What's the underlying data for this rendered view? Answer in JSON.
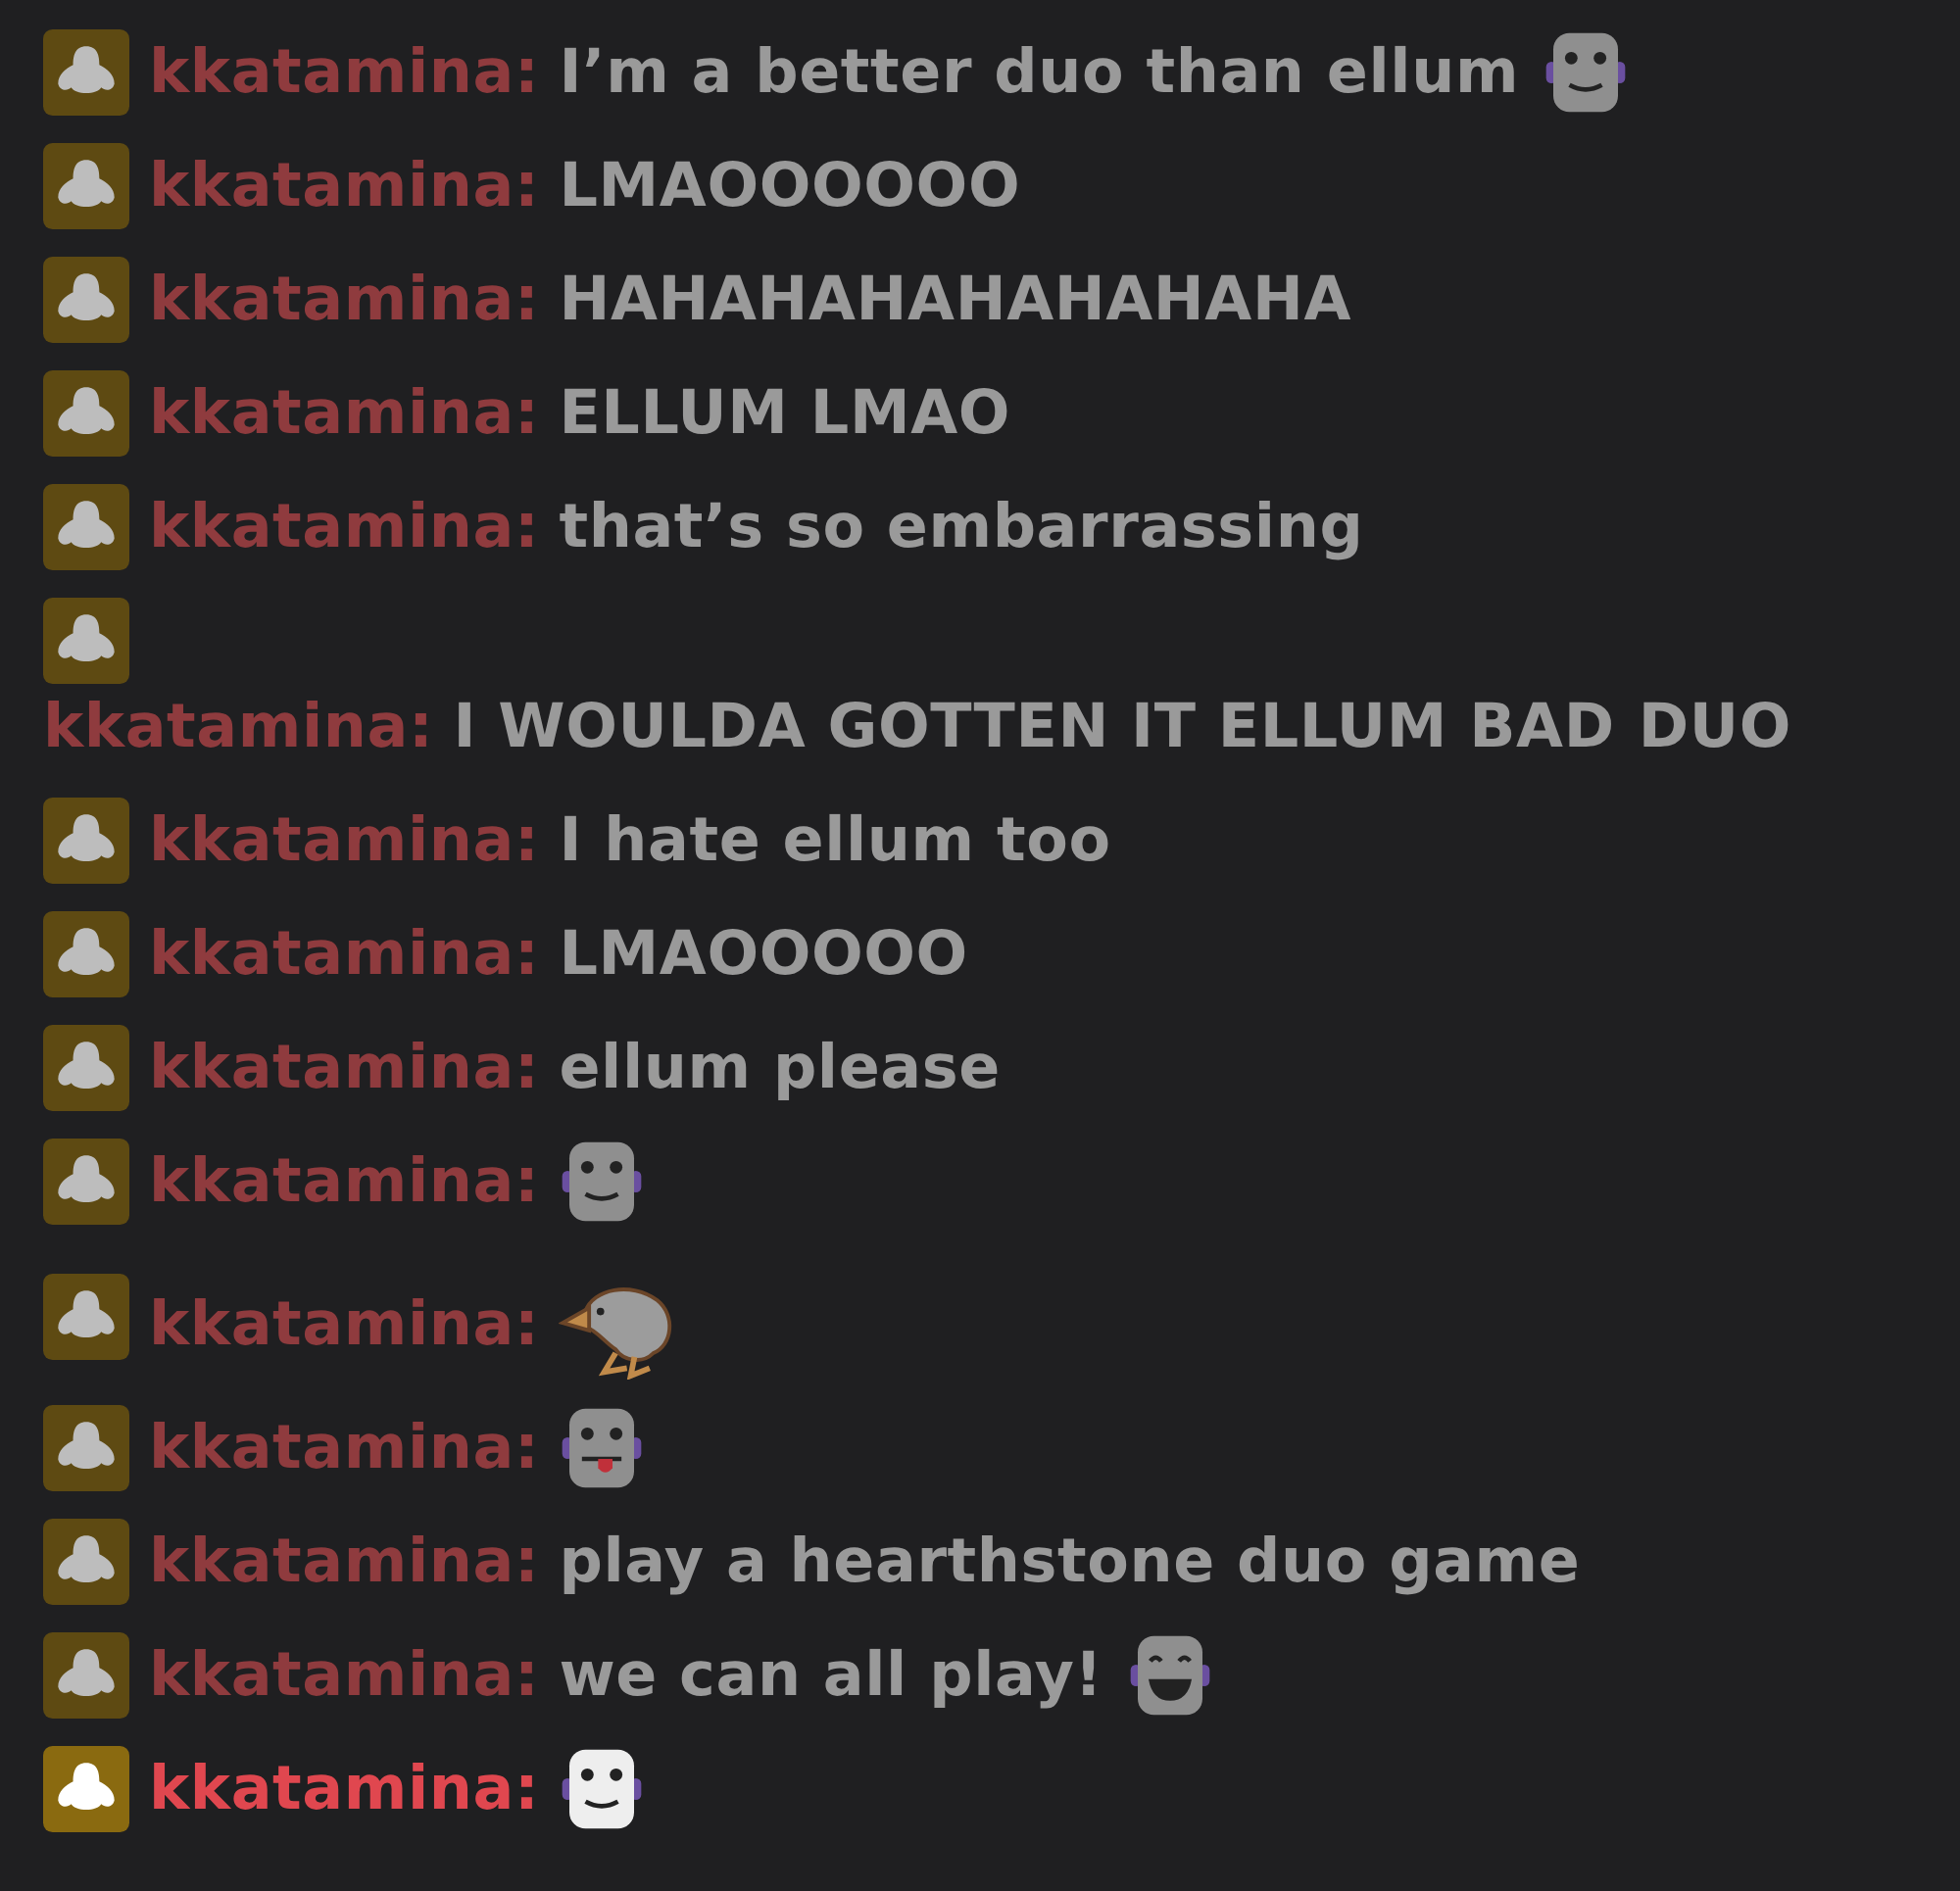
{
  "messages": [
    {
      "user": "kkatamina:",
      "faded": true,
      "parts": [
        {
          "kind": "text",
          "text": "I’m a better duo than ellum"
        },
        {
          "kind": "smile"
        }
      ]
    },
    {
      "user": "kkatamina:",
      "faded": true,
      "parts": [
        {
          "kind": "text",
          "text": "LMAOOOOOO"
        }
      ]
    },
    {
      "user": "kkatamina:",
      "faded": true,
      "parts": [
        {
          "kind": "text",
          "text": "HAHAHAHAHAHAHAHA"
        }
      ]
    },
    {
      "user": "kkatamina:",
      "faded": true,
      "parts": [
        {
          "kind": "text",
          "text": "ELLUM LMAO"
        }
      ]
    },
    {
      "user": "kkatamina:",
      "faded": true,
      "parts": [
        {
          "kind": "text",
          "text": "that’s so embarrassing"
        }
      ]
    },
    {
      "user": "kkatamina:",
      "faded": true,
      "parts": [
        {
          "kind": "text",
          "text": "I WOULDA GOTTEN IT ELLUM BAD"
        },
        {
          "kind": "text",
          "text": "DUO"
        }
      ]
    },
    {
      "user": "kkatamina:",
      "faded": true,
      "parts": [
        {
          "kind": "text",
          "text": "I hate ellum too"
        }
      ]
    },
    {
      "user": "kkatamina:",
      "faded": true,
      "parts": [
        {
          "kind": "text",
          "text": "LMAOOOOO"
        }
      ]
    },
    {
      "user": "kkatamina:",
      "faded": true,
      "parts": [
        {
          "kind": "text",
          "text": "ellum please"
        }
      ]
    },
    {
      "user": "kkatamina:",
      "faded": true,
      "parts": [
        {
          "kind": "smile"
        }
      ]
    },
    {
      "user": "kkatamina:",
      "faded": true,
      "parts": [
        {
          "kind": "bird"
        }
      ]
    },
    {
      "user": "kkatamina:",
      "faded": true,
      "parts": [
        {
          "kind": "tongue"
        }
      ]
    },
    {
      "user": "kkatamina:",
      "faded": true,
      "parts": [
        {
          "kind": "text",
          "text": "play a hearthstone duo game"
        }
      ]
    },
    {
      "user": "kkatamina:",
      "faded": true,
      "parts": [
        {
          "kind": "text",
          "text": "we can all play!"
        },
        {
          "kind": "grin"
        }
      ]
    },
    {
      "user": "kkatamina:",
      "faded": false,
      "parts": [
        {
          "kind": "smile"
        }
      ]
    }
  ]
}
